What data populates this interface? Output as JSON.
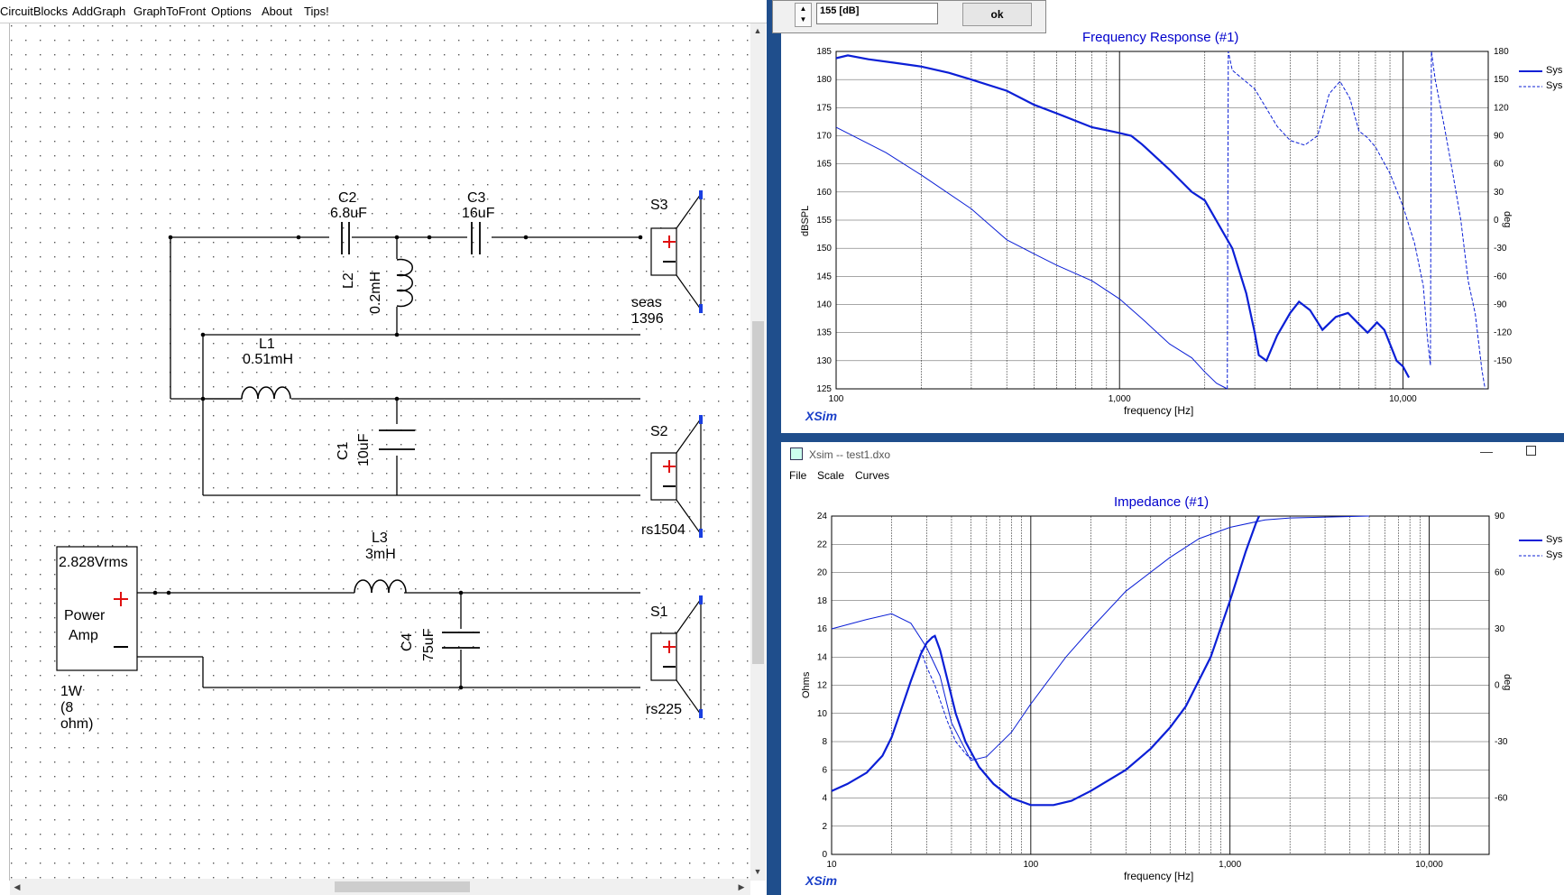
{
  "menu": [
    "CircuitBlocks",
    "AddGraph",
    "GraphToFront",
    "Options",
    "About",
    "Tips!"
  ],
  "dialog": {
    "value": "155 [dB]",
    "ok": "ok"
  },
  "schematic": {
    "c2": {
      "name": "C2",
      "value": "6.8uF"
    },
    "c3": {
      "name": "C3",
      "value": "16uF"
    },
    "s3": {
      "name": "S3",
      "model": "seas 1396"
    },
    "l2": {
      "name": "L2",
      "value": "0.2mH"
    },
    "l1": {
      "name": "L1",
      "value": "0.51mH"
    },
    "c1": {
      "name": "C1",
      "value": "10uF"
    },
    "s2": {
      "name": "S2",
      "model": "rs1504"
    },
    "l3": {
      "name": "L3",
      "value": "3mH"
    },
    "c4": {
      "name": "C4",
      "value": "75uF"
    },
    "s1": {
      "name": "S1",
      "model": "rs225"
    },
    "amp": {
      "voltage": "2.828Vrms",
      "line1": "Power",
      "line2": "Amp",
      "rating": "1W (8 ohm)"
    },
    "plus": "+",
    "minus": "−"
  },
  "colors": {
    "curve": "#0b1fd6",
    "grid": "#000000",
    "accent_title": "#0000cc",
    "terminal": "#1a3fe0"
  },
  "freq_window": {
    "brand": "XSim",
    "legend": [
      "Sys",
      "Sys"
    ],
    "chart_data": {
      "type": "line",
      "title": "Frequency Response (#1)",
      "xlabel": "frequency [Hz]",
      "ylabel": "dBSPL",
      "y2label": "deg",
      "xscale": "log",
      "xlim": [
        100,
        20000
      ],
      "ylim": [
        125,
        185
      ],
      "y2lim": [
        -180,
        180
      ],
      "x_tick_labels": [
        "100",
        "1,000",
        "10,000"
      ],
      "y_ticks": [
        "185",
        "180",
        "175",
        "170",
        "165",
        "160",
        "155",
        "150",
        "145",
        "140",
        "135",
        "130",
        "125"
      ],
      "y2_ticks": [
        "180",
        "150",
        "120",
        "90",
        "60",
        "30",
        "0",
        "-30",
        "-60",
        "-90",
        "-120",
        "-150"
      ],
      "series": [
        {
          "axis": "left",
          "style": "thick",
          "points": [
            [
              100,
              183.8
            ],
            [
              110,
              184.3
            ],
            [
              130,
              183.6
            ],
            [
              160,
              183
            ],
            [
              200,
              182.3
            ],
            [
              250,
              181.2
            ],
            [
              300,
              180
            ],
            [
              400,
              178
            ],
            [
              500,
              175.5
            ],
            [
              600,
              174
            ],
            [
              800,
              171.5
            ],
            [
              900,
              171
            ],
            [
              1000,
              170.5
            ],
            [
              1100,
              170
            ],
            [
              1200,
              168.5
            ],
            [
              1500,
              164
            ],
            [
              1800,
              160
            ],
            [
              2000,
              158.5
            ],
            [
              2500,
              150
            ],
            [
              2800,
              142
            ],
            [
              3000,
              135
            ],
            [
              3100,
              131
            ],
            [
              3300,
              130
            ],
            [
              3600,
              134.5
            ],
            [
              4000,
              138.5
            ],
            [
              4300,
              140.5
            ],
            [
              4700,
              139
            ],
            [
              5200,
              135.5
            ],
            [
              5800,
              137.8
            ],
            [
              6400,
              138.5
            ],
            [
              7000,
              136.5
            ],
            [
              7500,
              135
            ],
            [
              8100,
              136.8
            ],
            [
              8600,
              135.5
            ],
            [
              9000,
              133
            ],
            [
              9500,
              130
            ],
            [
              10000,
              129
            ],
            [
              10500,
              127
            ]
          ]
        },
        {
          "axis": "left",
          "style": "thin",
          "points": [
            [
              100,
              171.5
            ],
            [
              150,
              167
            ],
            [
              200,
              163
            ],
            [
              300,
              157
            ],
            [
              400,
              151.5
            ],
            [
              500,
              149
            ],
            [
              600,
              147
            ],
            [
              800,
              144.2
            ],
            [
              1000,
              141
            ],
            [
              1200,
              137.5
            ],
            [
              1500,
              133
            ],
            [
              1800,
              130.5
            ],
            [
              2000,
              128
            ],
            [
              2200,
              126
            ],
            [
              2400,
              125
            ]
          ]
        },
        {
          "axis": "right",
          "style": "dashed",
          "points": [
            [
              2400,
              -180
            ],
            [
              2420,
              180
            ],
            [
              2500,
              160
            ],
            [
              3000,
              140
            ],
            [
              3600,
              100
            ],
            [
              4000,
              85
            ],
            [
              4500,
              80
            ],
            [
              5000,
              90
            ],
            [
              5500,
              135
            ],
            [
              6000,
              148
            ],
            [
              6500,
              130
            ],
            [
              7000,
              95
            ],
            [
              7500,
              88
            ],
            [
              8000,
              78
            ],
            [
              9000,
              50
            ],
            [
              10000,
              15
            ],
            [
              11000,
              -25
            ],
            [
              11800,
              -70
            ],
            [
              12200,
              -125
            ],
            [
              12500,
              -155
            ],
            [
              12600,
              180
            ],
            [
              13000,
              150
            ],
            [
              14000,
              100
            ],
            [
              15000,
              50
            ],
            [
              16000,
              0
            ],
            [
              17000,
              -65
            ],
            [
              18000,
              -100
            ],
            [
              19000,
              -160
            ],
            [
              19500,
              -180
            ]
          ]
        }
      ]
    }
  },
  "imp_window": {
    "title": "Xsim -- test1.dxo",
    "menu": [
      "File",
      "Scale",
      "Curves"
    ],
    "brand": "XSim",
    "legend": [
      "Sys",
      "Sys"
    ],
    "chart_data": {
      "type": "line",
      "title": "Impedance (#1)",
      "xlabel": "frequency [Hz]",
      "ylabel": "Ohms",
      "y2label": "deg",
      "xscale": "log",
      "xlim": [
        10,
        20000
      ],
      "ylim": [
        0,
        24
      ],
      "y2lim": [
        -90,
        90
      ],
      "x_tick_labels": [
        "10",
        "100",
        "1,000",
        "10,000"
      ],
      "y_ticks": [
        "24",
        "22",
        "20",
        "18",
        "16",
        "14",
        "12",
        "10",
        "8",
        "6",
        "4",
        "2",
        "0"
      ],
      "y2_ticks": [
        "90",
        "60",
        "30",
        "0",
        "-30",
        "-60"
      ],
      "series": [
        {
          "axis": "left",
          "style": "thick",
          "points": [
            [
              10,
              4.5
            ],
            [
              12,
              5
            ],
            [
              15,
              5.8
            ],
            [
              18,
              7
            ],
            [
              20,
              8.3
            ],
            [
              22,
              10
            ],
            [
              25,
              12.3
            ],
            [
              28,
              14.2
            ],
            [
              30,
              15
            ],
            [
              32,
              15.4
            ],
            [
              33,
              15.5
            ],
            [
              35,
              14.5
            ],
            [
              38,
              12.5
            ],
            [
              42,
              10
            ],
            [
              47,
              8
            ],
            [
              55,
              6.2
            ],
            [
              65,
              5
            ],
            [
              80,
              4
            ],
            [
              100,
              3.5
            ],
            [
              130,
              3.5
            ],
            [
              160,
              3.8
            ],
            [
              200,
              4.5
            ],
            [
              300,
              6
            ],
            [
              400,
              7.5
            ],
            [
              500,
              9
            ],
            [
              600,
              10.5
            ],
            [
              800,
              14
            ],
            [
              1000,
              18
            ],
            [
              1200,
              21.5
            ],
            [
              1350,
              23.5
            ],
            [
              1400,
              24
            ]
          ]
        },
        {
          "axis": "right",
          "style": "thin",
          "points": [
            [
              10,
              30
            ],
            [
              15,
              35
            ],
            [
              20,
              38
            ],
            [
              25,
              33
            ],
            [
              30,
              20
            ],
            [
              35,
              5
            ],
            [
              40,
              -20
            ],
            [
              50,
              -40
            ],
            [
              60,
              -38
            ],
            [
              80,
              -25
            ],
            [
              100,
              -10
            ],
            [
              150,
              15
            ],
            [
              200,
              30
            ],
            [
              300,
              50
            ],
            [
              500,
              68
            ],
            [
              700,
              78
            ],
            [
              1000,
              84
            ],
            [
              1500,
              88
            ],
            [
              2000,
              89
            ],
            [
              5000,
              90
            ]
          ]
        },
        {
          "axis": "left",
          "style": "dashed",
          "points": [
            [
              28,
              14.5
            ],
            [
              30,
              13.3
            ],
            [
              33,
              12
            ],
            [
              38,
              9.5
            ],
            [
              42,
              8
            ],
            [
              48,
              7
            ],
            [
              52,
              6.7
            ]
          ]
        }
      ]
    }
  }
}
